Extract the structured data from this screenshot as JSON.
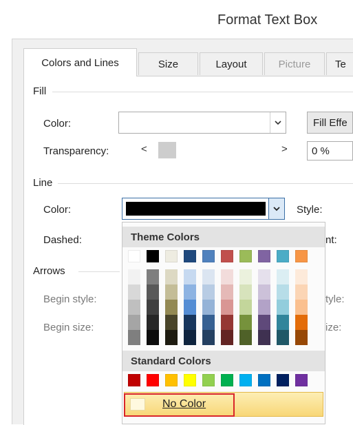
{
  "window": {
    "title": "Format Text Box"
  },
  "tabs": [
    {
      "label": "Colors and Lines",
      "active": true,
      "enabled": true
    },
    {
      "label": "Size",
      "active": false,
      "enabled": true
    },
    {
      "label": "Layout",
      "active": false,
      "enabled": true
    },
    {
      "label": "Picture",
      "active": false,
      "enabled": false
    },
    {
      "label": "Te",
      "active": false,
      "enabled": true
    }
  ],
  "fill": {
    "section_label": "Fill",
    "color_label": "Color:",
    "color_value": "",
    "fill_effects_label": "Fill Effe",
    "transparency_label": "Transparency:",
    "transparency_value": "0 %",
    "transparency_left_arrow": "<",
    "transparency_right_arrow": ">"
  },
  "line": {
    "section_label": "Line",
    "color_label": "Color:",
    "color_value_hex": "#000000",
    "style_label": "Style:",
    "dashed_label": "Dashed:",
    "weight_label_partial": "nt:"
  },
  "arrows": {
    "section_label": "Arrows",
    "begin_style_label": "Begin style:",
    "begin_size_label": "Begin size:",
    "end_style_partial": "tyle:",
    "end_size_partial": "ize:"
  },
  "color_picker": {
    "theme_header": "Theme Colors",
    "theme_top_row": [
      "#ffffff",
      "#000000",
      "#eeece1",
      "#1f497d",
      "#4f81bd",
      "#c0504d",
      "#9bbb59",
      "#8064a2",
      "#4bacc6",
      "#f79646"
    ],
    "theme_shades": [
      [
        "#f2f2f2",
        "#d8d8d8",
        "#bfbfbf",
        "#a5a5a5",
        "#7f7f7f"
      ],
      [
        "#7f7f7f",
        "#595959",
        "#3f3f3f",
        "#262626",
        "#0c0c0c"
      ],
      [
        "#ddd9c3",
        "#c4bd97",
        "#938953",
        "#494429",
        "#1d1b10"
      ],
      [
        "#c6d9f0",
        "#8db3e2",
        "#548dd4",
        "#17365d",
        "#0f243e"
      ],
      [
        "#dbe5f1",
        "#b8cce4",
        "#95b3d7",
        "#366092",
        "#244061"
      ],
      [
        "#f2dcdb",
        "#e5b9b7",
        "#d99694",
        "#953734",
        "#632423"
      ],
      [
        "#ebf1dd",
        "#d7e3bc",
        "#c3d69b",
        "#76923c",
        "#4f6128"
      ],
      [
        "#e5e0ec",
        "#ccc1d9",
        "#b2a2c7",
        "#5f497a",
        "#3f3151"
      ],
      [
        "#dbeef3",
        "#b7dde8",
        "#92cddc",
        "#31859b",
        "#205867"
      ],
      [
        "#fdeada",
        "#fbd5b5",
        "#fac08f",
        "#e36c09",
        "#974806"
      ]
    ],
    "standard_header": "Standard Colors",
    "standard_colors": [
      "#c00000",
      "#ff0000",
      "#ffc000",
      "#ffff00",
      "#92d050",
      "#00b050",
      "#00b0f0",
      "#0070c0",
      "#002060",
      "#7030a0"
    ],
    "no_color_label": "No Color"
  }
}
